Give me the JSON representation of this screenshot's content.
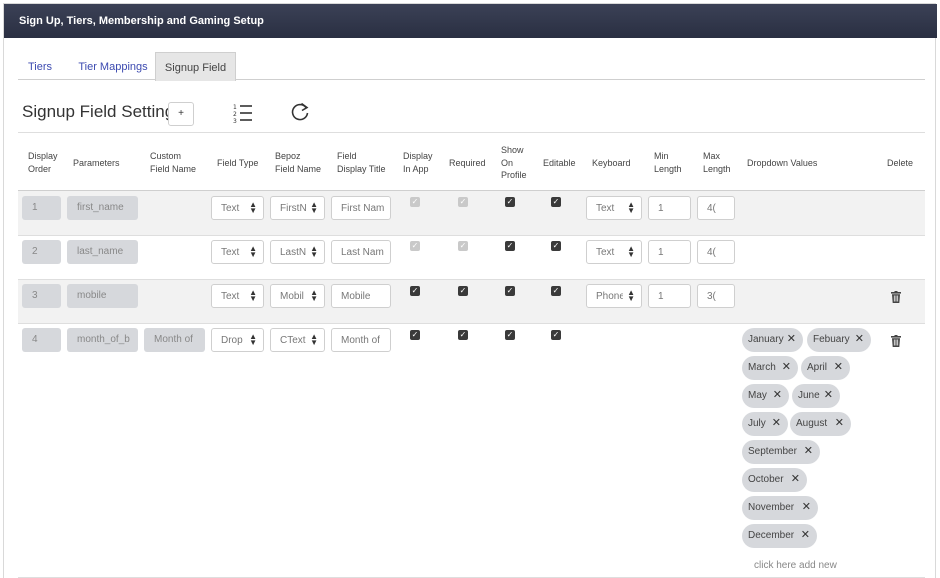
{
  "header": {
    "title": "Sign Up, Tiers, Membership and Gaming Setup"
  },
  "tabs": [
    {
      "label": "Tiers"
    },
    {
      "label": "Tier Mappings"
    },
    {
      "label": "Signup Field"
    }
  ],
  "section": {
    "title": "Signup Field Setting",
    "add_label": "+"
  },
  "columns": {
    "display_order": [
      "Display",
      "Order"
    ],
    "parameters": [
      "Parameters"
    ],
    "custom_field_name": [
      "Custom",
      "Field Name"
    ],
    "field_type": [
      "Field Type"
    ],
    "bepoz_field_name": [
      "Bepoz",
      "Field Name"
    ],
    "field_display_title": [
      "Field",
      "Display Title"
    ],
    "display_in_app": [
      "Display",
      "In App"
    ],
    "required": [
      "Required"
    ],
    "show_on_profile": [
      "Show",
      "On",
      "Profile"
    ],
    "editable": [
      "Editable"
    ],
    "keyboard": [
      "Keyboard"
    ],
    "min_length": [
      "Min",
      "Length"
    ],
    "max_length": [
      "Max",
      "Length"
    ],
    "dropdown_values": [
      "Dropdown Values"
    ],
    "delete": [
      "Delete"
    ]
  },
  "rows": [
    {
      "order": "1",
      "parameter": "first_name",
      "custom": "",
      "field_type": "Text",
      "bepoz_field": "FirstN",
      "display_title": "First Nam",
      "display_in_app": true,
      "required": true,
      "show_on_profile": true,
      "editable": true,
      "keyboard": "Text",
      "min": "1",
      "max": "4("
    },
    {
      "order": "2",
      "parameter": "last_name",
      "custom": "",
      "field_type": "Text",
      "bepoz_field": "LastN",
      "display_title": "Last Nam",
      "display_in_app": true,
      "required": true,
      "show_on_profile": true,
      "editable": true,
      "keyboard": "Text",
      "min": "1",
      "max": "4("
    },
    {
      "order": "3",
      "parameter": "mobile",
      "custom": "",
      "field_type": "Text",
      "bepoz_field": "Mobil",
      "display_title": "Mobile",
      "display_in_app": true,
      "required": true,
      "show_on_profile": true,
      "editable": true,
      "keyboard": "Phone",
      "min": "1",
      "max": "3("
    },
    {
      "order": "4",
      "parameter": "month_of_b",
      "custom": "Month of",
      "field_type": "Drop",
      "bepoz_field": "CText",
      "display_title": "Month of",
      "display_in_app": true,
      "required": true,
      "show_on_profile": true,
      "editable": true,
      "keyboard": "",
      "min": "",
      "max": ""
    }
  ],
  "dropdown_values": [
    "January",
    "Febuary",
    "March",
    "April",
    "May",
    "June",
    "July",
    "August",
    "September",
    "October",
    "November",
    "December"
  ],
  "add_new_label": "click here add new",
  "icons": {
    "list": "ordered-list-icon",
    "refresh": "refresh-icon",
    "delete": "trash-icon",
    "remove": "close-icon",
    "sort": "sort-arrows-icon",
    "check": "checkmark-icon"
  },
  "colors": {
    "header_bg": "#2f3448",
    "tab_link": "#3c4ab0",
    "row_stripe": "#f2f2f2",
    "chip_bg": "#d6d8dc"
  }
}
